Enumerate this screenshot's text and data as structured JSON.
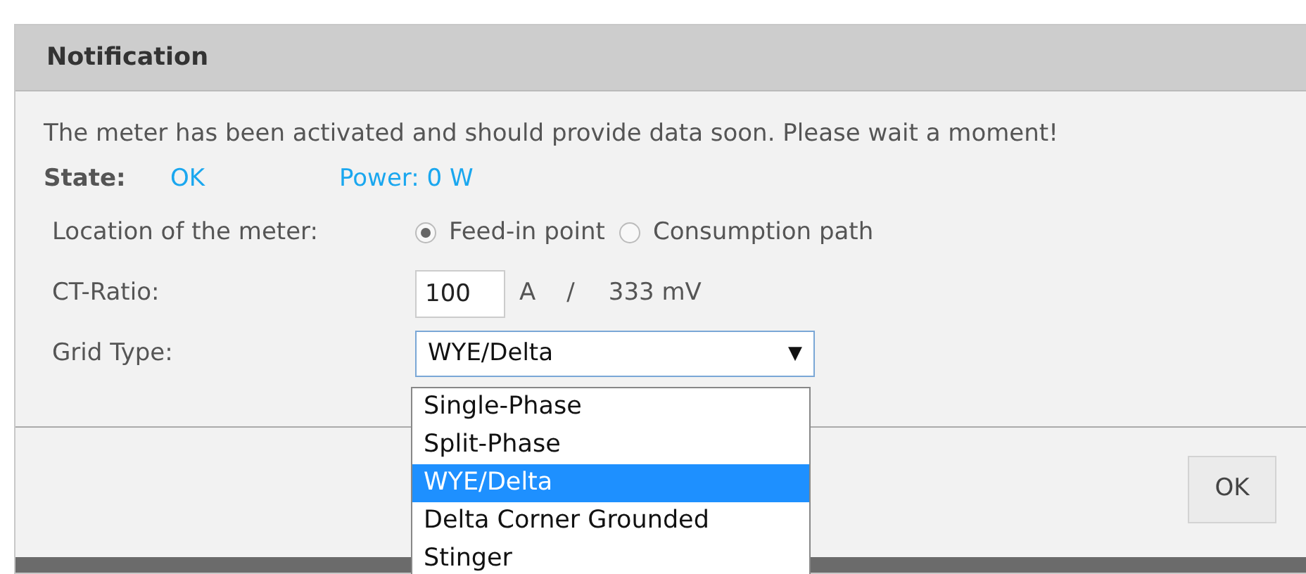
{
  "dialog": {
    "title": "Notification",
    "message": "The meter has been activated and should provide data soon. Please wait a moment!",
    "state": {
      "label": "State:",
      "value": "OK",
      "power": "Power: 0 W"
    },
    "location": {
      "label": "Location of the meter:",
      "options": [
        {
          "label": "Feed-in point",
          "selected": true
        },
        {
          "label": "Consumption path",
          "selected": false
        }
      ]
    },
    "ct_ratio": {
      "label": "CT-Ratio:",
      "value": "100",
      "unit": "A",
      "separator": "/",
      "secondary": "333 mV"
    },
    "grid_type": {
      "label": "Grid Type:",
      "value": "WYE/Delta",
      "caret": "▼",
      "expanded": true,
      "options": [
        {
          "label": "Single-Phase",
          "selected": false
        },
        {
          "label": "Split-Phase",
          "selected": false
        },
        {
          "label": "WYE/Delta",
          "selected": true
        },
        {
          "label": "Delta Corner Grounded",
          "selected": false
        },
        {
          "label": "Stinger",
          "selected": false
        }
      ]
    },
    "buttons": [
      "OK"
    ]
  }
}
